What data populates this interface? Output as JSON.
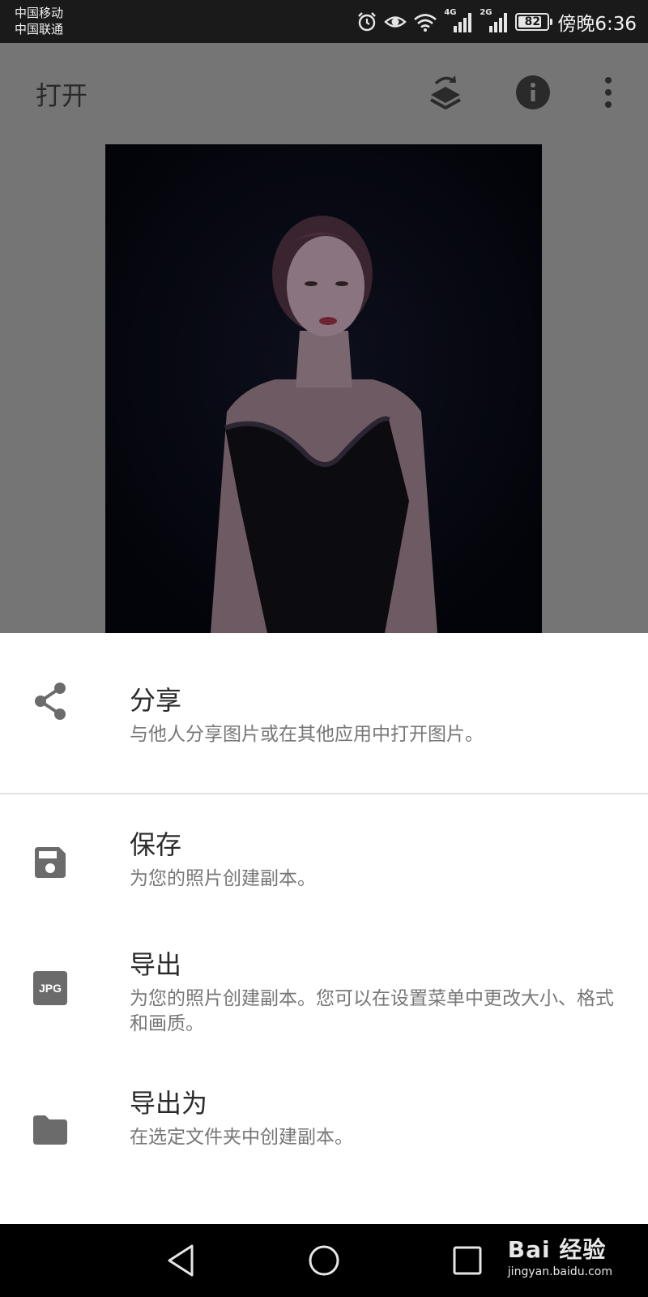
{
  "status_bar": {
    "carrier_1": "中国移动",
    "carrier_2": "中国联通",
    "network_1": "4G",
    "network_2": "2G",
    "battery": "82",
    "battery_level": 0.82,
    "time": "傍晚6:36"
  },
  "app_bar": {
    "title": "打开",
    "icons": [
      "layers-switch-icon",
      "info-icon",
      "more-vert-icon"
    ]
  },
  "sheet": {
    "items": [
      {
        "icon": "share-icon",
        "title": "分享",
        "description": "与他人分享图片或在其他应用中打开图片。"
      },
      {
        "icon": "save-icon",
        "title": "保存",
        "description": "为您的照片创建副本。"
      },
      {
        "icon": "jpg-icon",
        "icon_text": "JPG",
        "title": "导出",
        "description": "为您的照片创建副本。您可以在设置菜单中更改大小、格式和画质。"
      },
      {
        "icon": "folder-icon",
        "title": "导出为",
        "description": "在选定文件夹中创建副本。"
      }
    ]
  },
  "nav_bar": {
    "buttons": [
      "back-icon",
      "home-icon",
      "recents-icon"
    ]
  },
  "watermark": {
    "brand": "Bai 经验",
    "url": "jingyan.baidu.com"
  },
  "colors": {
    "status_bar_bg": "#1a1a1a",
    "dim_overlay": "#757575",
    "sheet_bg": "#ffffff",
    "icon_gray": "#6b6b6b"
  }
}
